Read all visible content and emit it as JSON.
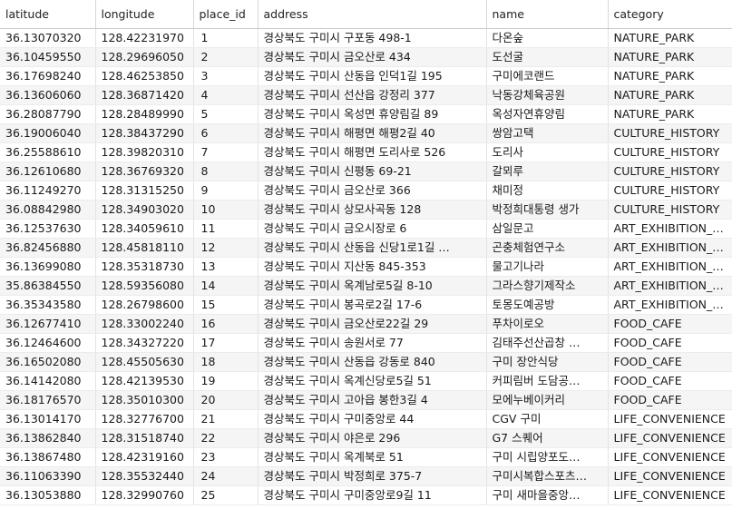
{
  "columns": {
    "latitude": "latitude",
    "longitude": "longitude",
    "place_id": "place_id",
    "address": "address",
    "name": "name",
    "category": "category"
  },
  "rows": [
    {
      "latitude": "36.13070320",
      "longitude": "128.42231970",
      "place_id": "1",
      "address": "경상북도 구미시 구포동 498-1",
      "name": "다온숲",
      "category": "NATURE_PARK"
    },
    {
      "latitude": "36.10459550",
      "longitude": "128.29696050",
      "place_id": "2",
      "address": "경상북도 구미시 금오산로 434",
      "name": "도선굴",
      "category": "NATURE_PARK"
    },
    {
      "latitude": "36.17698240",
      "longitude": "128.46253850",
      "place_id": "3",
      "address": "경상북도 구미시 산동읍 인덕1길 195",
      "name": "구미에코랜드",
      "category": "NATURE_PARK"
    },
    {
      "latitude": "36.13606060",
      "longitude": "128.36871420",
      "place_id": "4",
      "address": "경상북도 구미시 선산읍 강정리 377",
      "name": "낙동강체육공원",
      "category": "NATURE_PARK"
    },
    {
      "latitude": "36.28087790",
      "longitude": "128.28489990",
      "place_id": "5",
      "address": "경상북도 구미시 옥성면 휴양림길 89",
      "name": "옥성자연휴양림",
      "category": "NATURE_PARK"
    },
    {
      "latitude": "36.19006040",
      "longitude": "128.38437290",
      "place_id": "6",
      "address": "경상북도 구미시 해평면 해평2길 40",
      "name": "쌍암고택",
      "category": "CULTURE_HISTORY"
    },
    {
      "latitude": "36.25588610",
      "longitude": "128.39820310",
      "place_id": "7",
      "address": "경상북도 구미시 해평면 도리사로 526",
      "name": "도리사",
      "category": "CULTURE_HISTORY"
    },
    {
      "latitude": "36.12610680",
      "longitude": "128.36769320",
      "place_id": "8",
      "address": "경상북도 구미시 신평동 69-21",
      "name": "갈뫼루",
      "category": "CULTURE_HISTORY"
    },
    {
      "latitude": "36.11249270",
      "longitude": "128.31315250",
      "place_id": "9",
      "address": "경상북도 구미시 금오산로 366",
      "name": "채미정",
      "category": "CULTURE_HISTORY"
    },
    {
      "latitude": "36.08842980",
      "longitude": "128.34903020",
      "place_id": "10",
      "address": "경상북도 구미시 상모사곡동 128",
      "name": "박정희대통령 생가",
      "category": "CULTURE_HISTORY"
    },
    {
      "latitude": "36.12537630",
      "longitude": "128.34059610",
      "place_id": "11",
      "address": "경상북도 구미시 금오시장로 6",
      "name": "삼일문고",
      "category": "ART_EXHIBITION_…"
    },
    {
      "latitude": "36.82456880",
      "longitude": "128.45818110",
      "place_id": "12",
      "address": "경상북도 구미시 산동읍 신당1로1길 …",
      "name": "곤충체험연구소",
      "category": "ART_EXHIBITION_…"
    },
    {
      "latitude": "36.13699080",
      "longitude": "128.35318730",
      "place_id": "13",
      "address": "경상북도 구미시 지산동 845-353",
      "name": "물고기나라",
      "category": "ART_EXHIBITION_…"
    },
    {
      "latitude": "35.86384550",
      "longitude": "128.59356080",
      "place_id": "14",
      "address": "경상북도 구미시 옥계남로5길 8-10",
      "name": "그라스향기제작소",
      "category": "ART_EXHIBITION_…"
    },
    {
      "latitude": "36.35343580",
      "longitude": "128.26798600",
      "place_id": "15",
      "address": "경상북도 구미시 봉곡로2길 17-6",
      "name": "토몽도예공방",
      "category": "ART_EXHIBITION_…"
    },
    {
      "latitude": "36.12677410",
      "longitude": "128.33002240",
      "place_id": "16",
      "address": "경상북도 구미시 금오산로22길 29",
      "name": "푸차이로오",
      "category": "FOOD_CAFE"
    },
    {
      "latitude": "36.12464600",
      "longitude": "128.34327220",
      "place_id": "17",
      "address": "경상북도 구미시 송원서로 77",
      "name": "김태주선산곱창 …",
      "category": "FOOD_CAFE"
    },
    {
      "latitude": "36.16502080",
      "longitude": "128.45505630",
      "place_id": "18",
      "address": "경상북도 구미시 산동읍 강동로 840",
      "name": "구미 장안식당",
      "category": "FOOD_CAFE"
    },
    {
      "latitude": "36.14142080",
      "longitude": "128.42139530",
      "place_id": "19",
      "address": "경상북도 구미시 옥계신당로5길 51",
      "name": "커피림버 도담공…",
      "category": "FOOD_CAFE"
    },
    {
      "latitude": "36.18176570",
      "longitude": "128.35010300",
      "place_id": "20",
      "address": "경상북도 구미시 고아읍 봉한3길 4",
      "name": "모에누베이커리",
      "category": "FOOD_CAFE"
    },
    {
      "latitude": "36.13014170",
      "longitude": "128.32776700",
      "place_id": "21",
      "address": "경상북도 구미시 구미중앙로 44",
      "name": "CGV 구미",
      "category": "LIFE_CONVENIENCE"
    },
    {
      "latitude": "36.13862840",
      "longitude": "128.31518740",
      "place_id": "22",
      "address": "경상북도 구미시 야은로 296",
      "name": "G7 스퀘어",
      "category": "LIFE_CONVENIENCE"
    },
    {
      "latitude": "36.13867480",
      "longitude": "128.42319160",
      "place_id": "23",
      "address": "경상북도 구미시 옥계북로 51",
      "name": "구미 시립양포도…",
      "category": "LIFE_CONVENIENCE"
    },
    {
      "latitude": "36.11063390",
      "longitude": "128.35532440",
      "place_id": "24",
      "address": "경상북도 구미시 박정희로 375-7",
      "name": "구미시복합스포츠…",
      "category": "LIFE_CONVENIENCE"
    },
    {
      "latitude": "36.13053880",
      "longitude": "128.32990760",
      "place_id": "25",
      "address": "경상북도 구미시 구미중앙로9길 11",
      "name": "구미 새마을중앙…",
      "category": "LIFE_CONVENIENCE"
    }
  ]
}
